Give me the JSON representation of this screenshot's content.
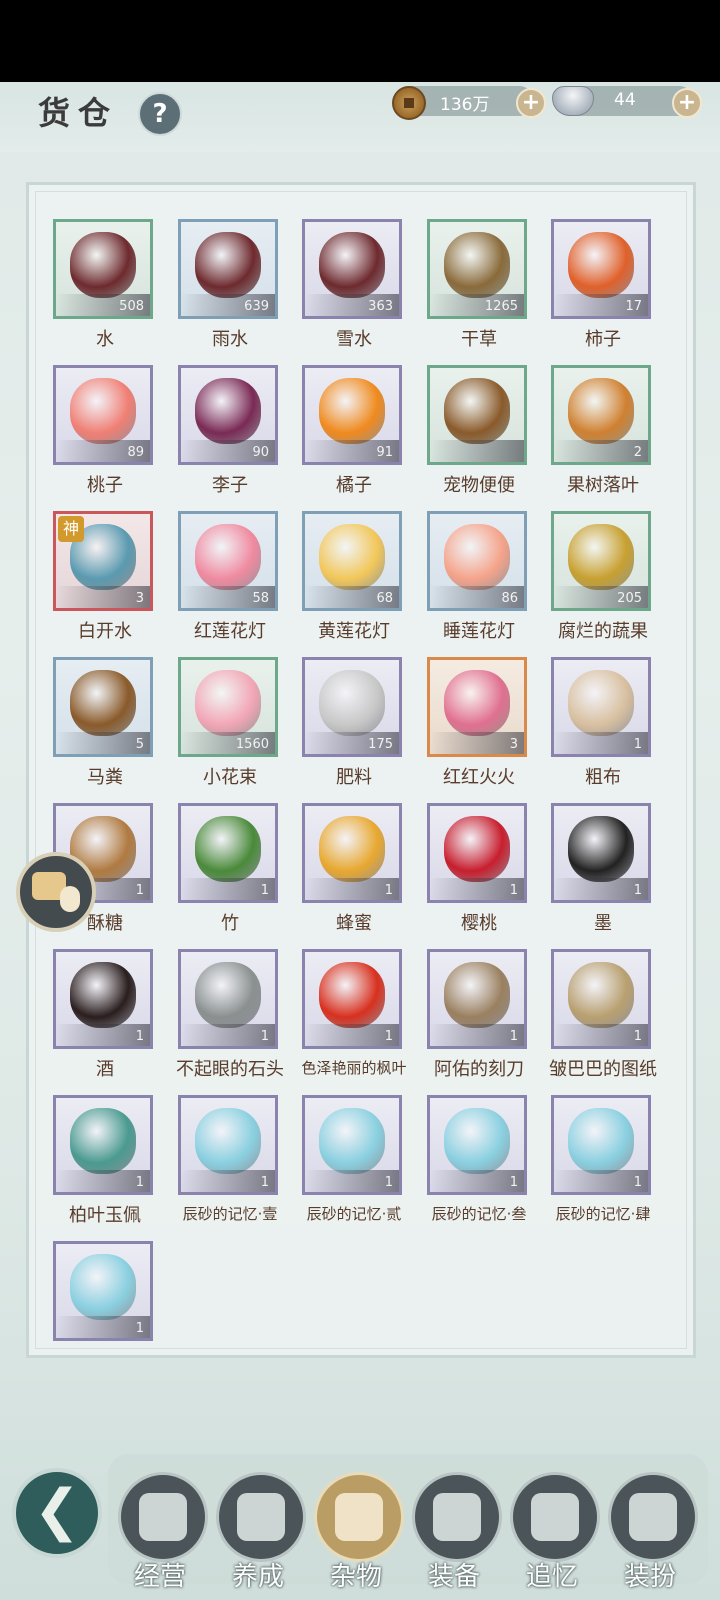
{
  "header": {
    "title": "货仓",
    "help_label": "?",
    "copper": "136万",
    "silver": "44",
    "plus_label": "+"
  },
  "items": [
    {
      "name": "水",
      "count": "508",
      "rarity": "green",
      "icon": "bucket-water-icon",
      "color": "#6e2a2e"
    },
    {
      "name": "雨水",
      "count": "639",
      "rarity": "blue",
      "icon": "bucket-rain-icon",
      "color": "#6e2a2e"
    },
    {
      "name": "雪水",
      "count": "363",
      "rarity": "purple",
      "icon": "bucket-snow-icon",
      "color": "#6e2a2e"
    },
    {
      "name": "干草",
      "count": "1265",
      "rarity": "green",
      "icon": "hay-icon",
      "color": "#8a6a3a"
    },
    {
      "name": "柿子",
      "count": "17",
      "rarity": "purple",
      "icon": "persimmon-icon",
      "color": "#e0602a"
    },
    {
      "name": "桃子",
      "count": "89",
      "rarity": "purple",
      "icon": "peach-icon",
      "color": "#f07f74"
    },
    {
      "name": "李子",
      "count": "90",
      "rarity": "purple",
      "icon": "plum-icon",
      "color": "#7a2a55"
    },
    {
      "name": "橘子",
      "count": "91",
      "rarity": "purple",
      "icon": "tangerine-icon",
      "color": "#f08a1e"
    },
    {
      "name": "宠物便便",
      "count": "",
      "rarity": "green",
      "icon": "pet-poop-icon",
      "color": "#8a5a2a"
    },
    {
      "name": "果树落叶",
      "count": "2",
      "rarity": "green",
      "icon": "fallen-leaf-icon",
      "color": "#d08030"
    },
    {
      "name": "白开水",
      "count": "3",
      "rarity": "red",
      "icon": "water-bowl-icon",
      "color": "#5a9ab0",
      "badge": "神"
    },
    {
      "name": "红莲花灯",
      "count": "58",
      "rarity": "blue",
      "icon": "red-lotus-lamp-icon",
      "color": "#f08aa0"
    },
    {
      "name": "黄莲花灯",
      "count": "68",
      "rarity": "blue",
      "icon": "yellow-lotus-lamp-icon",
      "color": "#f2c75a"
    },
    {
      "name": "睡莲花灯",
      "count": "86",
      "rarity": "blue",
      "icon": "water-lily-lamp-icon",
      "color": "#f5a38a"
    },
    {
      "name": "腐烂的蔬果",
      "count": "205",
      "rarity": "green",
      "icon": "rotten-fruit-icon",
      "color": "#c8a030"
    },
    {
      "name": "马粪",
      "count": "5",
      "rarity": "blue",
      "icon": "horse-dung-icon",
      "color": "#8a5a2a"
    },
    {
      "name": "小花束",
      "count": "1560",
      "rarity": "green",
      "icon": "flower-bouquet-icon",
      "color": "#f2a6b6"
    },
    {
      "name": "肥料",
      "count": "175",
      "rarity": "purple",
      "icon": "fertilizer-sack-icon",
      "color": "#c8c8c8"
    },
    {
      "name": "红红火火",
      "count": "3",
      "rarity": "orange",
      "icon": "firecracker-icon",
      "color": "#e07090"
    },
    {
      "name": "粗布",
      "count": "1",
      "rarity": "purple",
      "icon": "cloth-roll-icon",
      "color": "#d8c0a0"
    },
    {
      "name": "酥糖",
      "count": "1",
      "rarity": "purple",
      "icon": "crisp-candy-icon",
      "color": "#b07a40"
    },
    {
      "name": "竹",
      "count": "1",
      "rarity": "purple",
      "icon": "bamboo-icon",
      "color": "#4a8a3a"
    },
    {
      "name": "蜂蜜",
      "count": "1",
      "rarity": "purple",
      "icon": "honey-icon",
      "color": "#e8a830"
    },
    {
      "name": "樱桃",
      "count": "1",
      "rarity": "purple",
      "icon": "cherry-icon",
      "color": "#c81e2e"
    },
    {
      "name": "墨",
      "count": "1",
      "rarity": "purple",
      "icon": "ink-stick-icon",
      "color": "#222222"
    },
    {
      "name": "酒",
      "count": "1",
      "rarity": "purple",
      "icon": "wine-jar-icon",
      "color": "#2a1e1e"
    },
    {
      "name": "不起眼的石头",
      "count": "1",
      "rarity": "purple",
      "icon": "stone-icon",
      "color": "#8a9090"
    },
    {
      "name": "色泽艳丽的枫叶",
      "count": "1",
      "rarity": "purple",
      "icon": "maple-leaf-icon",
      "color": "#d8301e",
      "small": true
    },
    {
      "name": "阿佑的刻刀",
      "count": "1",
      "rarity": "purple",
      "icon": "carving-knife-icon",
      "color": "#9a8060"
    },
    {
      "name": "皱巴巴的图纸",
      "count": "1",
      "rarity": "purple",
      "icon": "crumpled-map-icon",
      "color": "#b8a070"
    },
    {
      "name": "柏叶玉佩",
      "count": "1",
      "rarity": "purple",
      "icon": "jade-pendant-icon",
      "color": "#4a9a90"
    },
    {
      "name": "辰砂的记忆·壹",
      "count": "1",
      "rarity": "purple",
      "icon": "memory-book-icon",
      "color": "#8ad0e0",
      "small": true
    },
    {
      "name": "辰砂的记忆·贰",
      "count": "1",
      "rarity": "purple",
      "icon": "memory-book-icon",
      "color": "#8ad0e0",
      "small": true
    },
    {
      "name": "辰砂的记忆·叁",
      "count": "1",
      "rarity": "purple",
      "icon": "memory-book-icon",
      "color": "#8ad0e0",
      "small": true
    },
    {
      "name": "辰砂的记忆·肆",
      "count": "1",
      "rarity": "purple",
      "icon": "memory-book-icon",
      "color": "#8ad0e0",
      "small": true
    },
    {
      "name": "",
      "count": "1",
      "rarity": "purple",
      "icon": "memory-book-icon",
      "color": "#8ad0e0"
    }
  ],
  "nav": {
    "back_glyph": "❮",
    "tabs": [
      {
        "label": "经营",
        "icon": "bowl-icon",
        "active": false
      },
      {
        "label": "养成",
        "icon": "gift-icon",
        "active": false
      },
      {
        "label": "杂物",
        "icon": "bundle-icon",
        "active": true
      },
      {
        "label": "装备",
        "icon": "robe-icon",
        "active": false
      },
      {
        "label": "追忆",
        "icon": "letter-icon",
        "active": false
      },
      {
        "label": "装扮",
        "icon": "pavilion-icon",
        "active": false
      }
    ]
  }
}
